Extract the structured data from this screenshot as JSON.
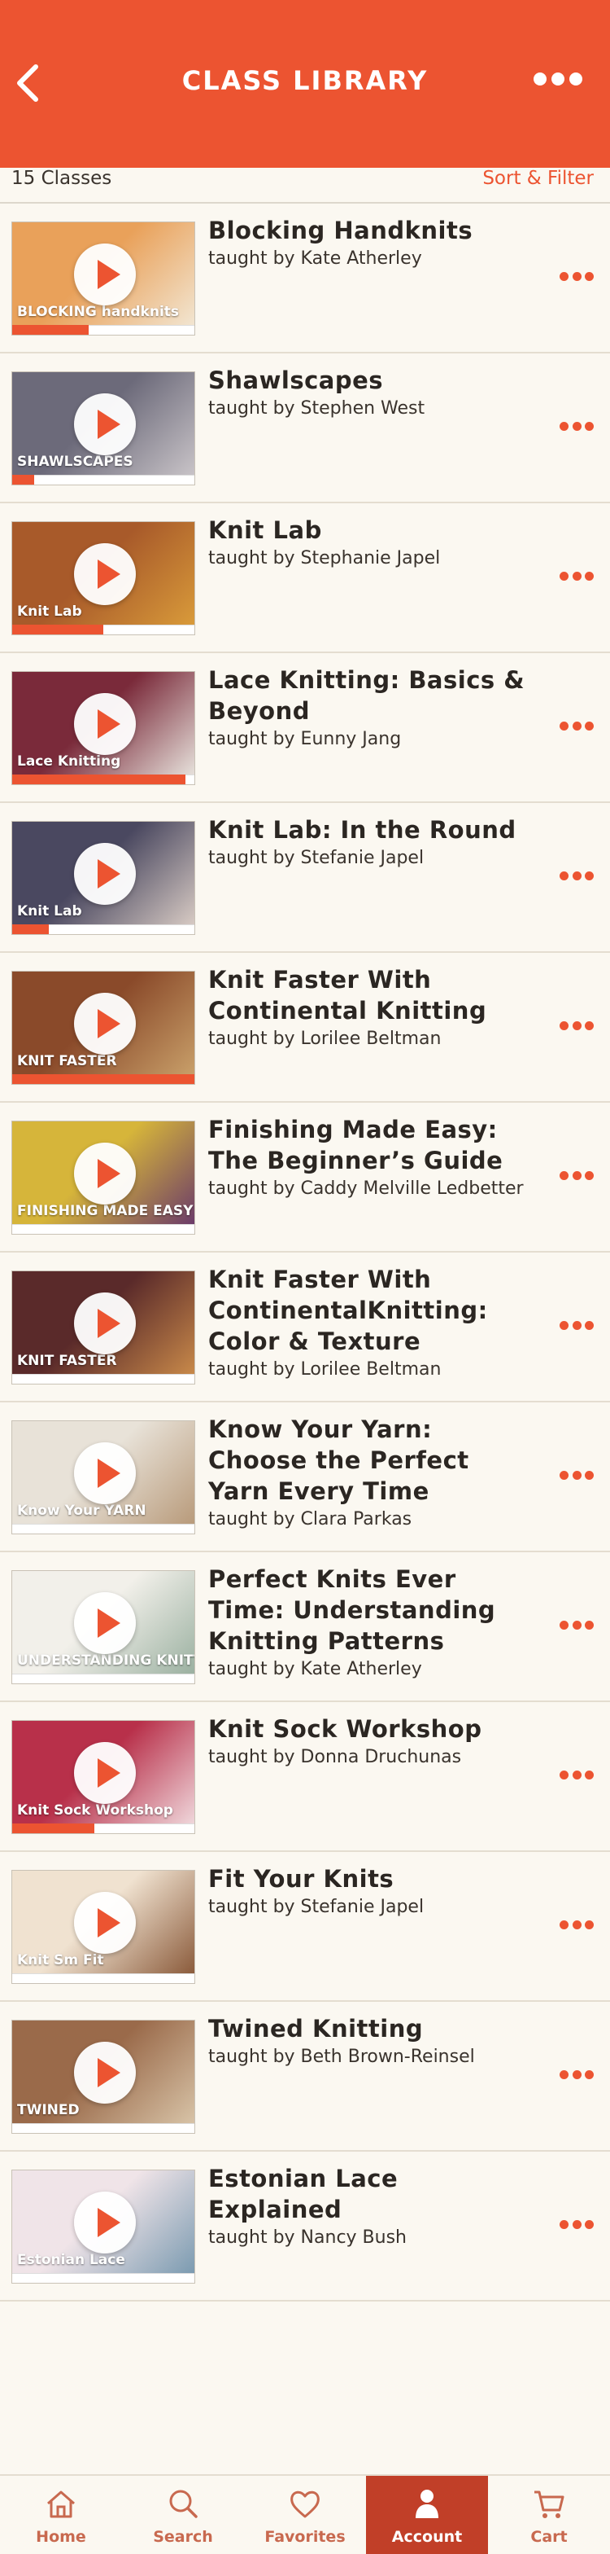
{
  "header": {
    "title": "CLASS LIBRARY"
  },
  "toolbar": {
    "count": "15 Classes",
    "sort_filter": "Sort & Filter"
  },
  "colors": {
    "accent": "#ec5431",
    "tab_active": "#c13f28",
    "background": "#fbf8f1"
  },
  "classes": [
    {
      "title": "Blocking Handknits",
      "instructor": "taught by Kate Atherley",
      "thumb_text": "BLOCKING handknits",
      "progress": 0.42,
      "thumb_colors": [
        "#e9a15a",
        "#f2e6d2"
      ]
    },
    {
      "title": "Shawlscapes",
      "instructor": "taught by Stephen West",
      "thumb_text": "SHAWLSCAPES",
      "progress": 0.12,
      "thumb_colors": [
        "#6c6a7a",
        "#c9c4c8"
      ]
    },
    {
      "title": "Knit Lab",
      "instructor": "taught by Stephanie Japel",
      "thumb_text": "Knit Lab",
      "progress": 0.5,
      "thumb_colors": [
        "#a85a2a",
        "#d99b3a"
      ]
    },
    {
      "title": "Lace Knitting: Basics & Beyond",
      "instructor": "taught by Eunny Jang",
      "thumb_text": "Lace Knitting",
      "progress": 0.95,
      "thumb_colors": [
        "#7a2a3a",
        "#e7e2dc"
      ]
    },
    {
      "title": "Knit Lab: In the Round",
      "instructor": "taught by Stefanie Japel",
      "thumb_text": "Knit Lab",
      "progress": 0.2,
      "thumb_colors": [
        "#4a4860",
        "#d8cbc4"
      ]
    },
    {
      "title": "Knit Faster With Continental Knitting",
      "instructor": "taught by Lorilee Beltman",
      "thumb_text": "KNIT FASTER",
      "progress": 1.0,
      "thumb_colors": [
        "#8a4a2a",
        "#c9a06a"
      ]
    },
    {
      "title": "Finishing Made Easy: The Beginner’s Guide",
      "instructor": "taught by Caddy Melville Ledbetter",
      "thumb_text": "FINISHING MADE EASY",
      "progress": 0.0,
      "thumb_colors": [
        "#d6b53a",
        "#6a3a6a"
      ]
    },
    {
      "title": "Knit Faster With ContinentalKnitting: Color & Texture",
      "instructor": "taught by Lorilee Beltman",
      "thumb_text": "KNIT FASTER",
      "progress": 0.0,
      "thumb_colors": [
        "#5a2a2a",
        "#c98a4a"
      ]
    },
    {
      "title": "Know Your Yarn: Choose the Perfect Yarn Every Time",
      "instructor": "taught by Clara Parkas",
      "thumb_text": "Know Your YARN",
      "progress": 0.0,
      "thumb_colors": [
        "#e8e2d8",
        "#b89a7a"
      ]
    },
    {
      "title": "Perfect Knits Ever Time: Understanding Knitting Patterns",
      "instructor": "taught by Kate Atherley",
      "thumb_text": "UNDERSTANDING KNITTING PATTERNS",
      "progress": 0.0,
      "thumb_colors": [
        "#f2f0ea",
        "#9ab0a0"
      ]
    },
    {
      "title": "Knit Sock Workshop",
      "instructor": "taught by Donna Druchunas",
      "thumb_text": "Knit Sock Workshop",
      "progress": 0.45,
      "thumb_colors": [
        "#b8304a",
        "#f0d8dc"
      ]
    },
    {
      "title": "Fit Your Knits",
      "instructor": "taught by Stefanie Japel",
      "thumb_text": "Knit Sm Fit",
      "progress": 0.0,
      "thumb_colors": [
        "#f0e2d0",
        "#8a5a3a"
      ]
    },
    {
      "title": "Twined Knitting",
      "instructor": "taught by Beth Brown-Reinsel",
      "thumb_text": "TWINED",
      "progress": 0.0,
      "thumb_colors": [
        "#9a6a4a",
        "#d8c4a8"
      ]
    },
    {
      "title": "Estonian Lace Explained",
      "instructor": "taught by Nancy Bush",
      "thumb_text": "Estonian Lace",
      "progress": 0.0,
      "thumb_colors": [
        "#f0e4e8",
        "#7a9ab0"
      ]
    }
  ],
  "tabs": [
    {
      "label": "Home",
      "icon": "home-icon",
      "active": false
    },
    {
      "label": "Search",
      "icon": "search-icon",
      "active": false
    },
    {
      "label": "Favorites",
      "icon": "heart-icon",
      "active": false
    },
    {
      "label": "Account",
      "icon": "user-icon",
      "active": true
    },
    {
      "label": "Cart",
      "icon": "cart-icon",
      "active": false
    }
  ]
}
